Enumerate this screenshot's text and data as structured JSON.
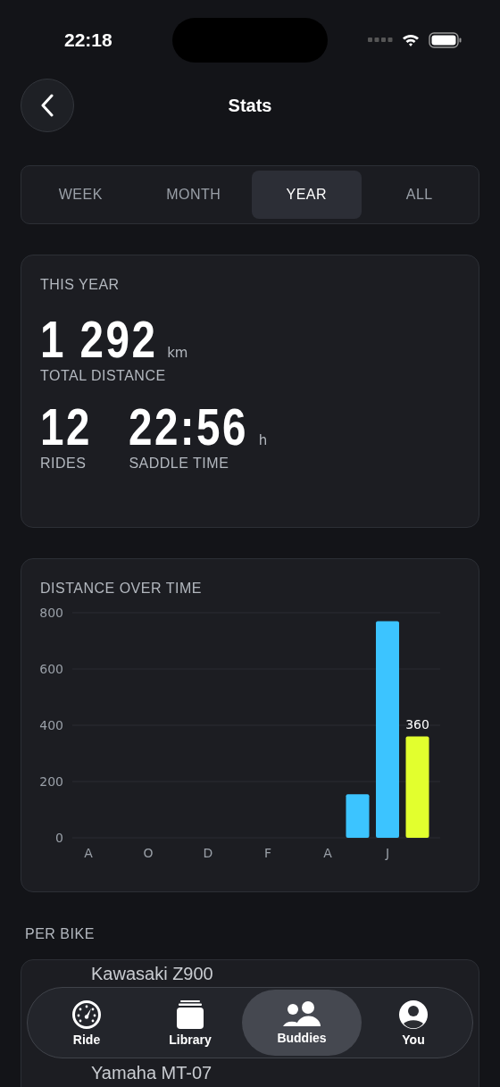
{
  "status_bar": {
    "time": "22:18"
  },
  "header": {
    "title": "Stats"
  },
  "period_tabs": [
    {
      "label": "WEEK",
      "selected": false
    },
    {
      "label": "MONTH",
      "selected": false
    },
    {
      "label": "YEAR",
      "selected": true
    },
    {
      "label": "ALL",
      "selected": false
    }
  ],
  "summary": {
    "title": "THIS YEAR",
    "distance": {
      "value": "1 292",
      "unit": "km",
      "label": "TOTAL DISTANCE"
    },
    "rides": {
      "value": "12",
      "label": "RIDES"
    },
    "saddle_time": {
      "value": "22:56",
      "unit": "h",
      "label": "SADDLE TIME"
    }
  },
  "distance_chart": {
    "title": "DISTANCE OVER TIME",
    "chart_data": {
      "type": "bar",
      "categories": [
        "A",
        null,
        "O",
        null,
        "D",
        null,
        "F",
        null,
        "A",
        null,
        "J",
        null
      ],
      "stacked": true,
      "series": [
        {
          "color": "#3cc4ff",
          "values": [
            0,
            0,
            0,
            0,
            0,
            0,
            0,
            0,
            0,
            155,
            770,
            null
          ]
        },
        {
          "color": "#e2ff2e",
          "values": [
            null,
            null,
            null,
            null,
            null,
            null,
            null,
            null,
            null,
            null,
            null,
            360
          ]
        }
      ],
      "ylim": [
        0,
        800
      ],
      "grid": true,
      "yticks": [
        0,
        200,
        400,
        600,
        800
      ],
      "annotations": [
        "360"
      ]
    }
  },
  "per_bike": {
    "title": "PER BIKE",
    "bikes": [
      {
        "name": "Kawasaki Z900"
      },
      {
        "name": "Yamaha MT-07"
      }
    ]
  },
  "tab_bar": [
    {
      "kind": "ride",
      "label": "Ride",
      "selected": false
    },
    {
      "kind": "library",
      "label": "Library",
      "selected": false
    },
    {
      "kind": "buddies",
      "label": "Buddies",
      "selected": true
    },
    {
      "kind": "you",
      "label": "You",
      "selected": false
    }
  ]
}
